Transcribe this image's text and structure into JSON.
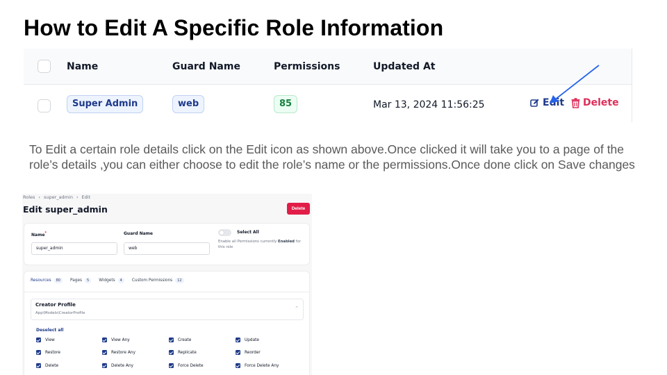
{
  "slide": {
    "title": "How to Edit A Specific Role Information",
    "description": "To Edit a certain role details click on the Edit icon as shown above.Once clicked it will take you to a page of the role’s details ,you can either choose to edit the role’s name or the permissions.Once done click on Save changes"
  },
  "roles_table": {
    "columns": [
      "Name",
      "Guard Name",
      "Permissions",
      "Updated At"
    ],
    "row": {
      "name": "Super Admin",
      "guard": "web",
      "permissions": "85",
      "updated_at": "Mar 13, 2024 11:56:25",
      "edit_label": "Edit",
      "delete_label": "Delete"
    }
  },
  "edit_page": {
    "breadcrumbs": [
      "Roles",
      "super_admin",
      "Edit"
    ],
    "title": "Edit super_admin",
    "delete_label": "Delete",
    "name_label": "Name",
    "name_value": "super_admin",
    "guard_label": "Guard Name",
    "guard_value": "web",
    "select_all_label": "Select All",
    "select_all_help_prefix": "Enable all Permissions currently",
    "select_all_help_state": "Enabled",
    "select_all_help_suffix": "for this role",
    "tabs": [
      {
        "label": "Resources",
        "count": "80"
      },
      {
        "label": "Pages",
        "count": "5"
      },
      {
        "label": "Widgets",
        "count": "4"
      },
      {
        "label": "Custom Permissions",
        "count": "12"
      }
    ],
    "section_title": "Creator Profile",
    "section_subtitle": "App\\Models\\CreatorProfile",
    "deselect_label": "Deselect all",
    "permissions": [
      [
        "View",
        "View Any",
        "Create",
        "Update"
      ],
      [
        "Restore",
        "Restore Any",
        "Replicate",
        "Reorder"
      ],
      [
        "Delete",
        "Delete Any",
        "Force Delete",
        "Force Delete Any"
      ]
    ]
  },
  "colors": {
    "accent": "#1e3a8a",
    "danger": "#dc2f5a",
    "arrow": "#2563eb"
  }
}
